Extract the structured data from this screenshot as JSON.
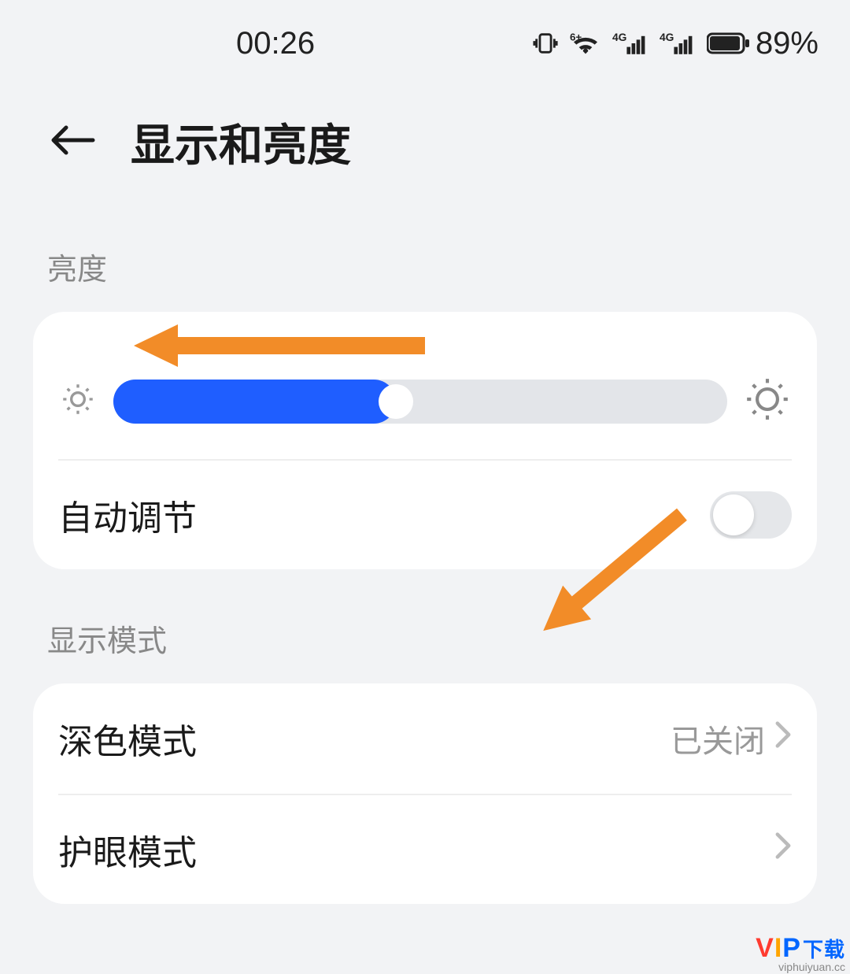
{
  "status": {
    "time": "00:26",
    "battery_percent": "89%"
  },
  "header": {
    "title": "显示和亮度"
  },
  "brightness": {
    "section_label": "亮度",
    "slider_percent": 46,
    "auto_label": "自动调节",
    "auto_on": false
  },
  "display_mode": {
    "section_label": "显示模式",
    "dark_mode_label": "深色模式",
    "dark_mode_value": "已关闭",
    "eye_mode_label": "护眼模式"
  },
  "watermark": {
    "brand_v": "V",
    "brand_i": "I",
    "brand_p": "P",
    "brand_dl": "下载",
    "url": "viphuiyuan.cc"
  },
  "colors": {
    "accent": "#1f5eff",
    "arrow": "#f28c28"
  }
}
